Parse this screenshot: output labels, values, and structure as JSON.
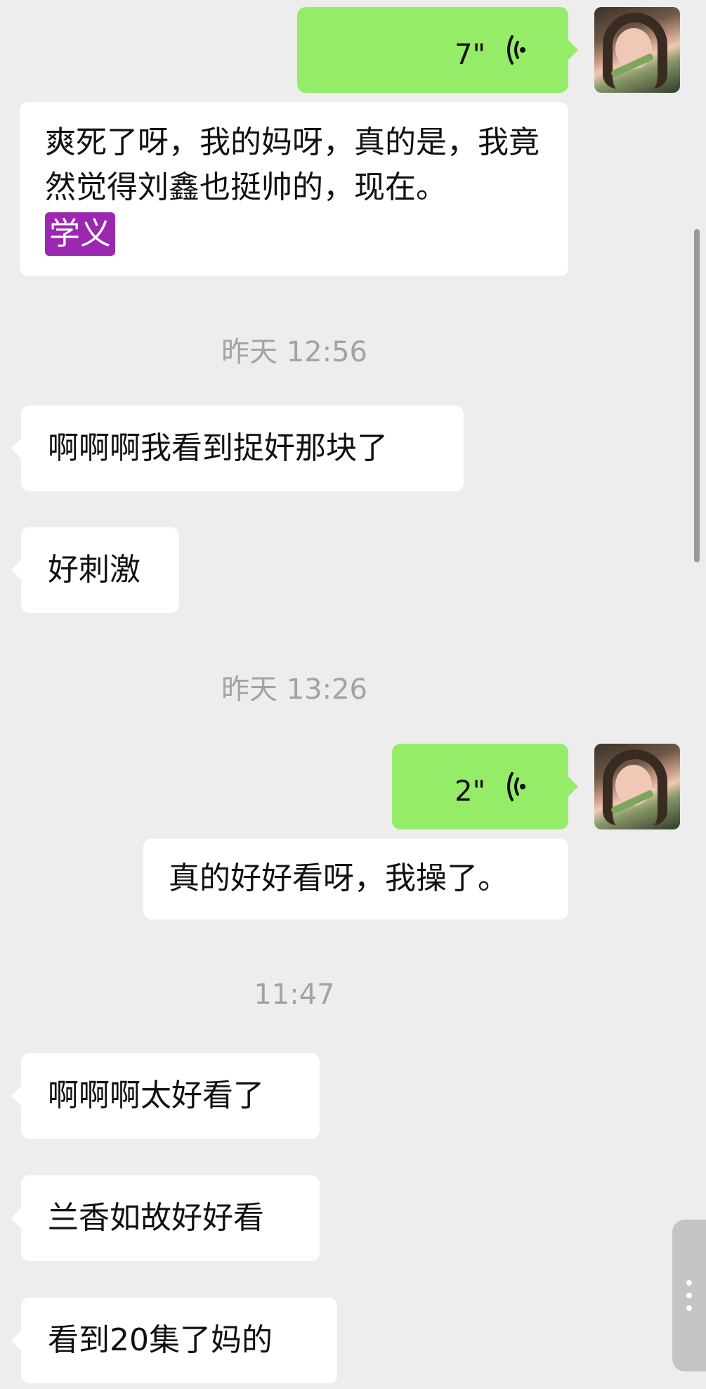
{
  "messages": {
    "voice1_duration": "7\"",
    "received1_text": "爽死了呀，我的妈呀，真的是，我竟然觉得刘鑫也挺帅的，现在。",
    "received1_highlight": "学义",
    "time1": "昨天 12:56",
    "in1": "啊啊啊我看到捉奸那块了",
    "in2": "好刺激",
    "time2": "昨天 13:26",
    "voice2_duration": "2\"",
    "out_text": "真的好好看呀，我操了。",
    "time3": "11:47",
    "in3": "啊啊啊太好看了",
    "in4": "兰香如故好好看",
    "in5": "看到20集了妈的"
  },
  "colors": {
    "background": "#ededed",
    "outgoing_bubble": "#95ec69",
    "incoming_bubble": "#ffffff",
    "highlight": "#9b28b0",
    "timestamp": "#a3a3a3"
  },
  "icons": {
    "voice": "voice-waves-icon",
    "more": "more-vertical-icon"
  }
}
